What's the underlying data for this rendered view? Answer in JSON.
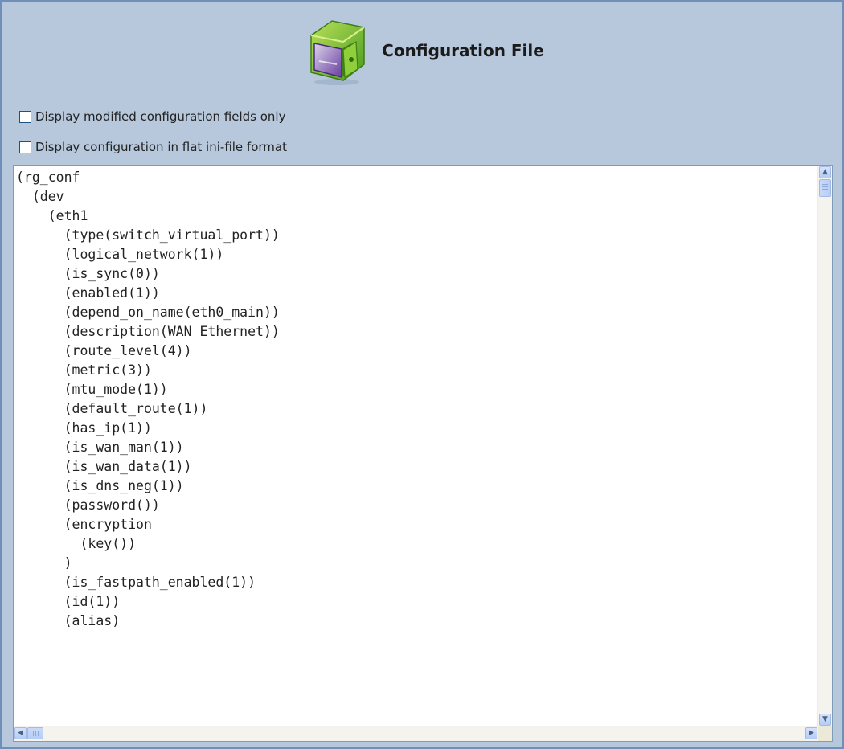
{
  "header": {
    "title": "Configuration File",
    "icon": "safe-icon"
  },
  "options": [
    {
      "label": "Display modified configuration fields only",
      "checked": false
    },
    {
      "label": "Display configuration in flat ini-file format",
      "checked": false
    }
  ],
  "config_lines": [
    "(rg_conf",
    "  (dev",
    "    (eth1",
    "      (type(switch_virtual_port))",
    "      (logical_network(1))",
    "      (is_sync(0))",
    "      (enabled(1))",
    "      (depend_on_name(eth0_main))",
    "      (description(WAN Ethernet))",
    "      (route_level(4))",
    "      (metric(3))",
    "      (mtu_mode(1))",
    "      (default_route(1))",
    "      (has_ip(1))",
    "      (is_wan_man(1))",
    "      (is_wan_data(1))",
    "      (is_dns_neg(1))",
    "      (password())",
    "      (encryption",
    "        (key())",
    "      )",
    "      (is_fastpath_enabled(1))",
    "      (id(1))",
    "      (alias)"
  ],
  "colors": {
    "panel_bg": "#b7c8dd",
    "panel_border": "#6f8fb8",
    "icon_green": "#6bb82e",
    "icon_purple": "#6a3ea0"
  }
}
